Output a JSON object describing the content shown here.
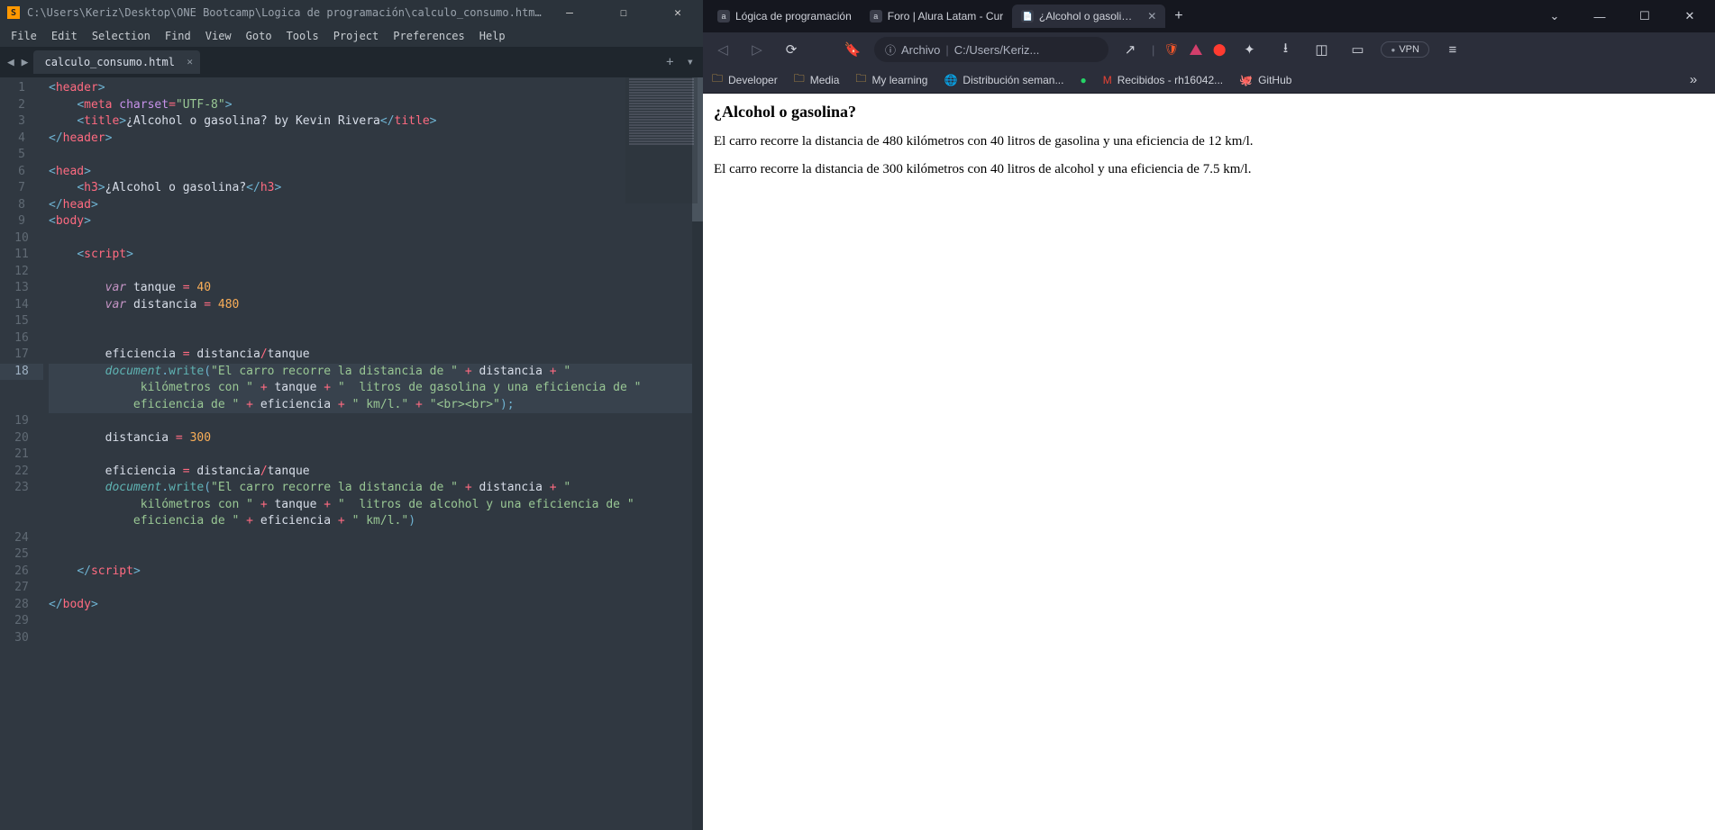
{
  "sublime": {
    "title": "C:\\Users\\Keriz\\Desktop\\ONE Bootcamp\\Logica de programación\\calculo_consumo.html - Sublime Text (UNREG...",
    "menu": [
      "File",
      "Edit",
      "Selection",
      "Find",
      "View",
      "Goto",
      "Tools",
      "Project",
      "Preferences",
      "Help"
    ],
    "tab": "calculo_consumo.html",
    "gutter": [
      "1",
      "2",
      "3",
      "4",
      "5",
      "6",
      "7",
      "8",
      "9",
      "10",
      "11",
      "12",
      "13",
      "14",
      "15",
      "16",
      "17",
      "18",
      "",
      "",
      "19",
      "20",
      "21",
      "22",
      "23",
      "",
      "",
      "24",
      "25",
      "26",
      "27",
      "28",
      "29",
      "30"
    ],
    "current_line": "18"
  },
  "browser": {
    "tabs": [
      {
        "label": "Lógica de programación",
        "active": false,
        "fav": "a"
      },
      {
        "label": "Foro | Alura Latam - Cur",
        "active": false,
        "fav": "a"
      },
      {
        "label": "¿Alcohol o gasolina?",
        "active": true,
        "fav": "🕮"
      }
    ],
    "url_scheme": "Archivo",
    "url_path": "C:/Users/Keriz...",
    "vpn": "VPN",
    "bookmarks": [
      {
        "icon": "folder",
        "label": "Developer"
      },
      {
        "icon": "folder",
        "label": "Media"
      },
      {
        "icon": "folder",
        "label": "My learning"
      },
      {
        "icon": "globe",
        "label": "Distribución seman..."
      },
      {
        "icon": "whatsapp",
        "label": ""
      },
      {
        "icon": "gmail",
        "label": "Recibidos - rh16042..."
      },
      {
        "icon": "github",
        "label": "GitHub"
      }
    ],
    "page": {
      "heading": "¿Alcohol o gasolina?",
      "p1": "El carro recorre la distancia de 480 kilómetros con 40 litros de gasolina y una eficiencia de 12 km/l.",
      "p2": "El carro recorre la distancia de 300 kilómetros con 40 litros de alcohol y una eficiencia de 7.5 km/l."
    }
  },
  "code_fragments": {
    "header_open": "header",
    "meta": "meta",
    "charset_attr": "charset",
    "charset_val": "\"UTF-8\"",
    "title": "title",
    "title_text": "¿Alcohol o gasolina? by Kevin Rivera",
    "head": "head",
    "h3": "h3",
    "h3_text": "¿Alcohol o gasolina?",
    "body": "body",
    "script": "script",
    "var": "var",
    "tanque": "tanque",
    "eq40": "40",
    "distancia": "distancia",
    "eq480": "480",
    "eficiencia": "eficiencia",
    "document": "document",
    "write": "write",
    "str1": "\"El carro recorre la distancia de \"",
    "str2": "\" kilómetros con \"",
    "str3": "\"  litros de gasolina y una eficiencia de \"",
    "str4": "\" km/l.\"",
    "strbr": "\"<br><br>\"",
    "eq300": "300",
    "str3b": "\"  litros de alcohol y una eficiencia de \"",
    "plus": "+"
  }
}
